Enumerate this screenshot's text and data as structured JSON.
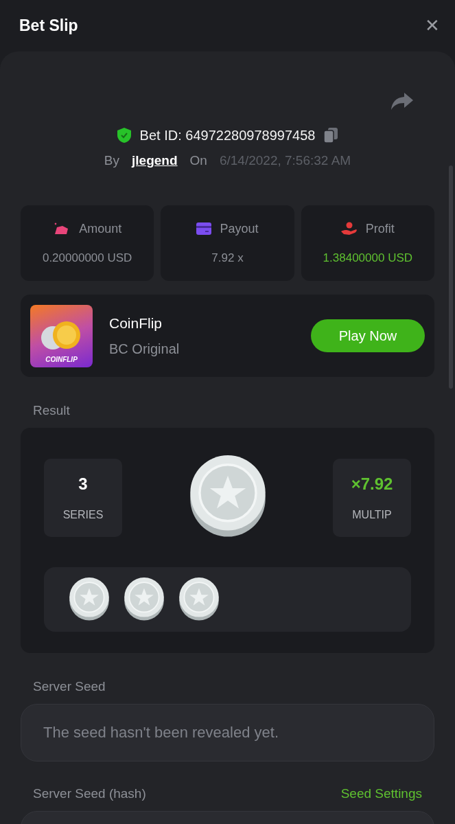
{
  "header": {
    "title": "Bet Slip",
    "close": "✕"
  },
  "bet": {
    "id_label": "Bet ID: 64972280978997458",
    "verified": true,
    "by_label": "By",
    "user": "jlegend",
    "on_label": "On",
    "time": "6/14/2022, 7:56:32 AM"
  },
  "stats": [
    {
      "kind": "amount",
      "label": "Amount",
      "value": "0.20000000 USD",
      "positive": false
    },
    {
      "kind": "payout",
      "label": "Payout",
      "value": "7.92 x",
      "positive": false
    },
    {
      "kind": "profit",
      "label": "Profit",
      "value": "1.38400000 USD",
      "positive": true
    }
  ],
  "game": {
    "logo_text": "COINFLIP",
    "name": "CoinFlip",
    "provider": "BC Original",
    "button": "Play Now"
  },
  "result": {
    "label": "Result",
    "series": "3",
    "series_label": "SERIES",
    "multiplier": "×7.92",
    "multiplier_label": "MULTIP"
  },
  "server_seed": {
    "label": "Server Seed",
    "placeholder": "The seed hasn't been revealed yet."
  },
  "server_seed_hash": {
    "label": "Server Seed (hash)",
    "link": "Seed Settings"
  }
}
